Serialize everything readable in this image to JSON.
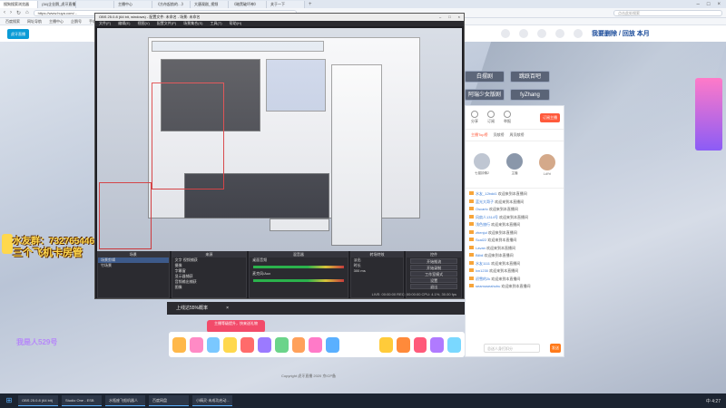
{
  "browser": {
    "tabs": [
      "搜狗搜索浏览器",
      "(34)企业鹅_虎牙直播",
      "",
      "主播中心",
      "《方舟起航的…》",
      "大唐观剧_视频",
      "《暗黑破坏神》",
      "关于一下"
    ],
    "url": "https://www.huya.com/...",
    "search_placeholder": "点击此处搜索",
    "bookmarks": [
      "百度搜索",
      "网址导航",
      "主播中心",
      "企鹅号",
      "手机版",
      "游戏大全"
    ]
  },
  "header": {
    "logo": "虎牙直播",
    "brand": "我要删除 / 回放 本月"
  },
  "overlays": {
    "fan_line": "水友群：732765446",
    "title_line": "三个飞机卡房管",
    "bottom_hint": "我是人529号"
  },
  "obs": {
    "title": "OBS 25.0.8 (64 bit, windows) - 配置文件: 未命名 - 场景: 未命名",
    "menu": [
      "文件(F)",
      "编辑(E)",
      "视图(V)",
      "配置文件(P)",
      "场景集合(S)",
      "工具(T)",
      "帮助(H)"
    ],
    "docks": {
      "scenes_title": "场景",
      "scenes": [
        "场景剪辑",
        "竹场景"
      ],
      "sources_title": "来源",
      "sources": [
        "文字 视频捕获",
        "摄像",
        "字幕窗",
        "显示器捕获",
        "音频输出捕获",
        "图像"
      ],
      "mixer_title": "混音器",
      "mixer": [
        "桌面音频",
        "麦克风/Aux"
      ],
      "transitions_title": "转场特效",
      "transition_value": "淡出",
      "duration_label": "时长",
      "duration_value": "300 ms",
      "controls_title": "控件",
      "controls": [
        "开始推流",
        "开始录制",
        "工作室模式",
        "设置",
        "退出"
      ]
    },
    "status": "LIVE: 00:00:00   REC: 00:00:00   CPU: 4.1%, 30.00 fps"
  },
  "stream_bar": {
    "text": "上线达55%概率"
  },
  "tip_text": "主播等级提升，快来送礼物",
  "channels": [
    "白摆剧",
    "跳跃百吧",
    "阿瑞少女版剧",
    "fyZhang"
  ],
  "chat": {
    "buttons": [
      "分享",
      "订阅",
      "举报"
    ],
    "follow_label": "订阅主播",
    "tabs": [
      "主播Top榜",
      "贡献榜",
      "周贡献榜"
    ],
    "fans": [
      "七猫钟情2",
      "主播",
      "LdYri"
    ],
    "messages": [
      {
        "user": "水友_12bdd1",
        "text": "欢迎来到本直播间"
      },
      {
        "user": "蓝光大哥子",
        "text": "欢迎来到本直播间"
      },
      {
        "user": "Oscarlo",
        "text": "欢迎来到本直播间"
      },
      {
        "user": "风扇人1314号",
        "text": "欢迎来到本直播间"
      },
      {
        "user": "浅色旅行",
        "text": "欢迎来到本直播间"
      },
      {
        "user": "zhenjul",
        "text": "欢迎来到本直播间"
      },
      {
        "user": "Scal22",
        "text": "欢迎来到本直播间"
      },
      {
        "user": "Lavan",
        "text": "欢迎来到本直播间"
      },
      {
        "user": "Bilbil",
        "text": "欢迎来到本直播间"
      },
      {
        "user": "水友1111",
        "text": "欢迎来到本直播间"
      },
      {
        "user": "lxn1230",
        "text": "欢迎来到本直播间"
      },
      {
        "user": "初雪的2k",
        "text": "欢迎来到本直播间"
      },
      {
        "user": "seamuseahuhu",
        "text": "欢迎来到本直播间"
      }
    ],
    "input_placeholder": "总送人身打扣分",
    "send_label": "发送"
  },
  "footer": "Copyright 虎牙直播 2020 京ICP备",
  "taskbar": {
    "tasks": [
      "OBS 25.0.8 (64 bit)",
      "Studio One - ESB",
      "水瓶座飞船机器人",
      "百度网盘",
      "小精灵·未成功启动..."
    ],
    "tray": "中 4:27"
  }
}
